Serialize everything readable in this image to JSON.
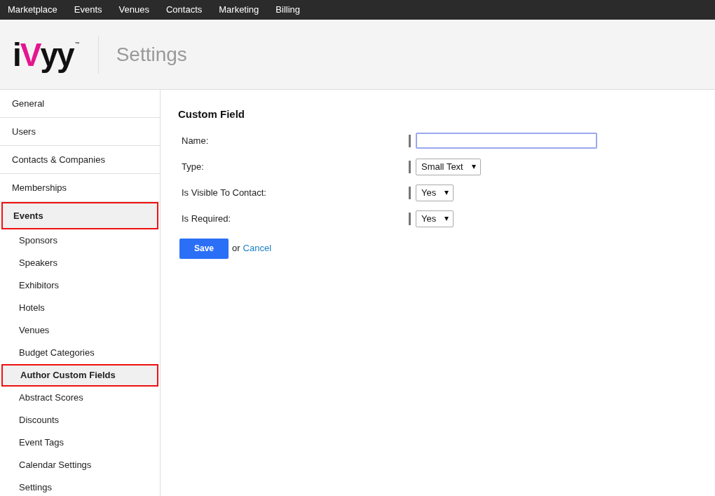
{
  "top_nav": [
    {
      "label": "Marketplace"
    },
    {
      "label": "Events"
    },
    {
      "label": "Venues"
    },
    {
      "label": "Contacts"
    },
    {
      "label": "Marketing"
    },
    {
      "label": "Billing"
    }
  ],
  "header": {
    "logo": "iVyy",
    "logo_mark": "™",
    "title": "Settings"
  },
  "sidebar": {
    "items": [
      {
        "label": "General",
        "selected": false
      },
      {
        "label": "Users",
        "selected": false
      },
      {
        "label": "Contacts & Companies",
        "selected": false
      },
      {
        "label": "Memberships",
        "selected": false
      },
      {
        "label": "Events",
        "selected": true,
        "children": [
          {
            "label": "Sponsors",
            "selected": false
          },
          {
            "label": "Speakers",
            "selected": false
          },
          {
            "label": "Exhibitors",
            "selected": false
          },
          {
            "label": "Hotels",
            "selected": false
          },
          {
            "label": "Venues",
            "selected": false
          },
          {
            "label": "Budget Categories",
            "selected": false
          },
          {
            "label": "Author Custom Fields",
            "selected": true
          },
          {
            "label": "Abstract Scores",
            "selected": false
          },
          {
            "label": "Discounts",
            "selected": false
          },
          {
            "label": "Event Tags",
            "selected": false
          },
          {
            "label": "Calendar Settings",
            "selected": false
          },
          {
            "label": "Settings",
            "selected": false
          }
        ]
      }
    ]
  },
  "form": {
    "title": "Custom Field",
    "fields": [
      {
        "label": "Name:",
        "kind": "text",
        "focused": true
      },
      {
        "label": "Type:",
        "kind": "select",
        "value": "Small Text"
      },
      {
        "label": "Is Visible To Contact:",
        "kind": "select",
        "value": "Yes"
      },
      {
        "label": "Is Required:",
        "kind": "select",
        "value": "Yes"
      }
    ],
    "save": "Save",
    "or": "or",
    "cancel": "Cancel"
  }
}
